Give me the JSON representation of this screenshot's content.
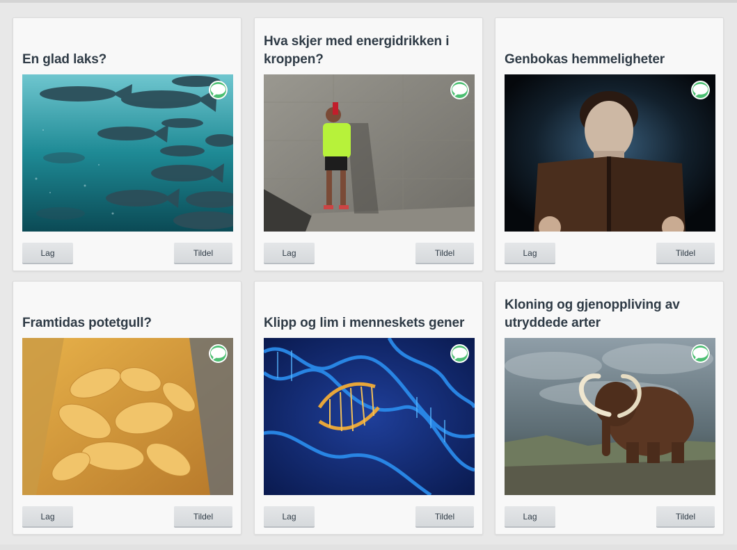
{
  "cards": [
    {
      "title": "En glad laks?",
      "image": "salmon-school-underwater",
      "lag_label": "Lag",
      "tildel_label": "Tildel",
      "badge_icon": "chat-bubble-icon"
    },
    {
      "title": "Hva skjer med energidrikken i kroppen?",
      "image": "runner-drinking-energy-drink",
      "lag_label": "Lag",
      "tildel_label": "Tildel",
      "badge_icon": "chat-bubble-icon"
    },
    {
      "title": "Genbokas hemmeligheter",
      "image": "man-reading-glowing-book",
      "lag_label": "Lag",
      "tildel_label": "Tildel",
      "badge_icon": "chat-bubble-icon"
    },
    {
      "title": "Framtidas potetgull?",
      "image": "bag-of-potato-chips",
      "lag_label": "Lag",
      "tildel_label": "Tildel",
      "badge_icon": "chat-bubble-icon"
    },
    {
      "title": "Klipp og lim i menneskets gener",
      "image": "dna-double-helix",
      "lag_label": "Lag",
      "tildel_label": "Tildel",
      "badge_icon": "chat-bubble-icon"
    },
    {
      "title": "Kloning og gjenoppliving av utryddede arter",
      "image": "woolly-mammoth",
      "lag_label": "Lag",
      "tildel_label": "Tildel",
      "badge_icon": "chat-bubble-icon"
    }
  ],
  "colors": {
    "page_background": "#e8e8e8",
    "card_background": "#f8f8f8",
    "title_text": "#2f3b46",
    "badge_green": "#4cbf72",
    "button_background": "#dcdfe2"
  }
}
